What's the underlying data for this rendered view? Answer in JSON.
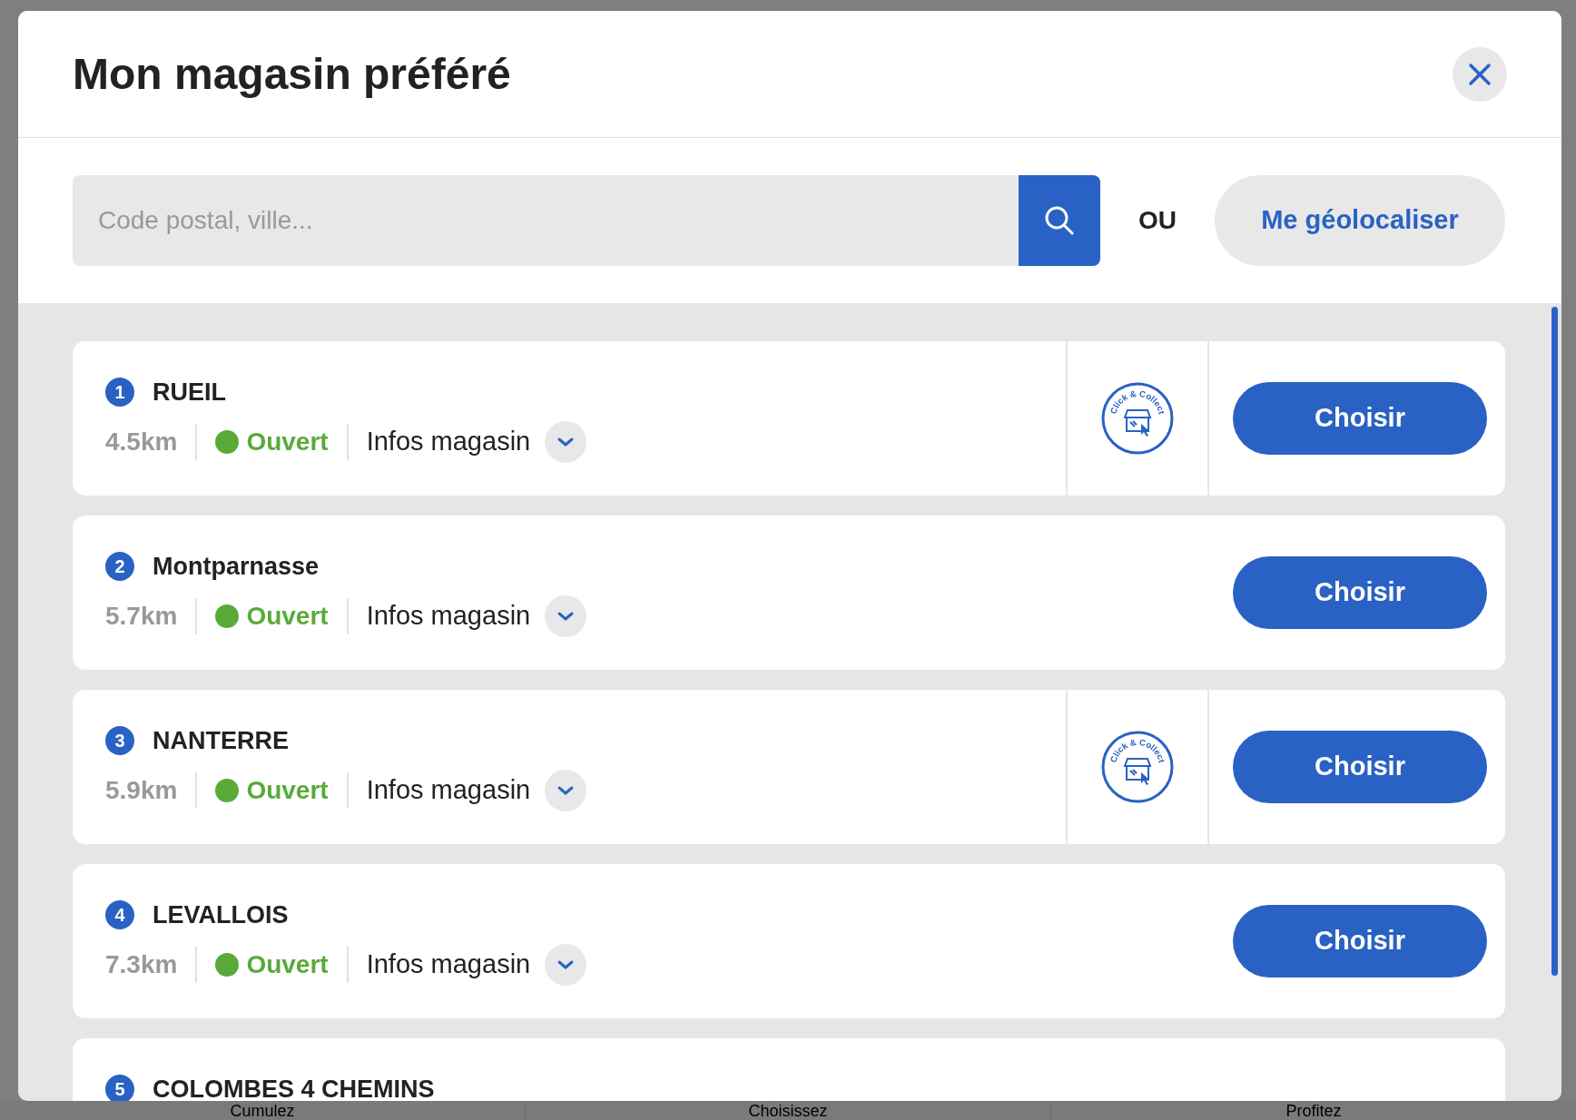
{
  "background_steps": [
    "Cumulez",
    "Choisissez",
    "Profitez"
  ],
  "modal": {
    "title": "Mon magasin préféré",
    "search": {
      "placeholder": "Code postal, ville..."
    },
    "separator": "OU",
    "geolocate_button": "Me géolocaliser",
    "stores": [
      {
        "number": "1",
        "name": "RUEIL",
        "distance": "4.5km",
        "status": "Ouvert",
        "open": true,
        "info_link": "Infos magasin",
        "click_collect": true,
        "badge_text": "Click & Collect",
        "button": "Choisir"
      },
      {
        "number": "2",
        "name": "Montparnasse",
        "distance": "5.7km",
        "status": "Ouvert",
        "open": true,
        "info_link": "Infos magasin",
        "click_collect": false,
        "button": "Choisir"
      },
      {
        "number": "3",
        "name": "NANTERRE",
        "distance": "5.9km",
        "status": "Ouvert",
        "open": true,
        "info_link": "Infos magasin",
        "click_collect": true,
        "badge_text": "Click & Collect",
        "button": "Choisir"
      },
      {
        "number": "4",
        "name": "LEVALLOIS",
        "distance": "7.3km",
        "status": "Ouvert",
        "open": true,
        "info_link": "Infos magasin",
        "click_collect": false,
        "button": "Choisir"
      },
      {
        "number": "5",
        "name": "COLOMBES 4 CHEMINS"
      }
    ]
  }
}
